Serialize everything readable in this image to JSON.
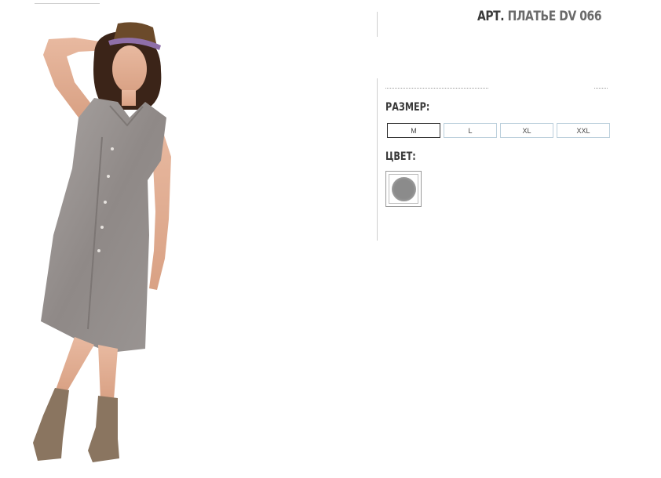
{
  "product": {
    "title_prefix": "АРТ.",
    "title_name": "ПЛАТЬЕ DV 066",
    "image_alt": "model-wearing-grey-linen-dress"
  },
  "options": {
    "size_label": "РАЗМЕР:",
    "sizes": [
      "M",
      "L",
      "XL",
      "XXL"
    ],
    "selected_size": "M",
    "color_label": "ЦВЕТ:",
    "colors": [
      {
        "name": "grey",
        "hex": "#8b8b8b"
      }
    ]
  }
}
